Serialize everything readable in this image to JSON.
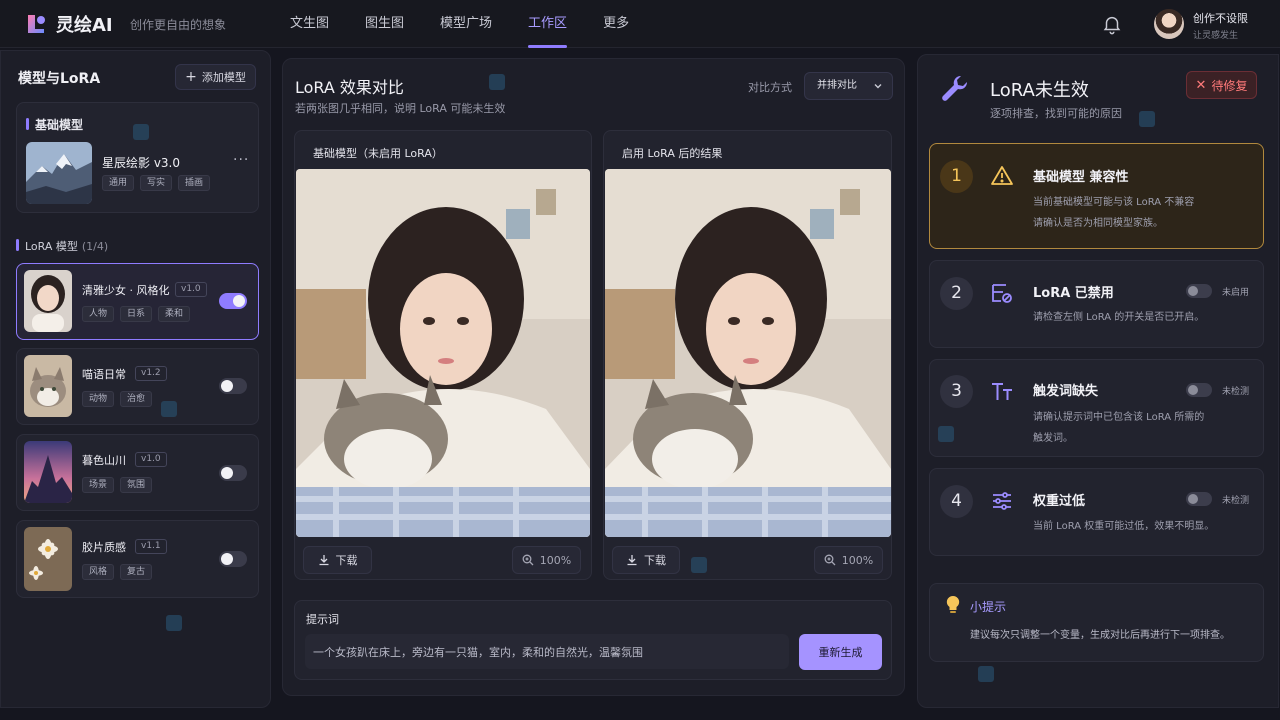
{
  "header": {
    "brand": "灵绘AI",
    "slogan": "创作更自由的想象",
    "nav": [
      "文生图",
      "图生图",
      "模型广场",
      "工作区",
      "更多"
    ],
    "active_nav": "工作区",
    "user_name": "创作不设限",
    "user_sub": "让灵感发生",
    "icons": [
      "logo-icon",
      "bell-icon",
      "avatar"
    ]
  },
  "left": {
    "title": "模型与LoRA",
    "add_button": "添加模型",
    "base_section": "基础模型",
    "base_model": {
      "name": "星辰绘影 v3.0",
      "tags": [
        "通用",
        "写实",
        "插画"
      ]
    },
    "lora_section": "LoRA 模型",
    "lora_count": "(1/4)",
    "loras": [
      {
        "name": "清雅少女 · 风格化",
        "version": "v1.0",
        "tags": [
          "人物",
          "日系",
          "柔和"
        ],
        "enabled": true
      },
      {
        "name": "喵语日常",
        "version": "v1.2",
        "tags": [
          "动物",
          "治愈"
        ],
        "enabled": false
      },
      {
        "name": "暮色山川",
        "version": "v1.0",
        "tags": [
          "场景",
          "氛围"
        ],
        "enabled": false
      },
      {
        "name": "胶片质感",
        "version": "v1.1",
        "tags": [
          "风格",
          "复古"
        ],
        "enabled": false
      }
    ]
  },
  "center": {
    "title": "LoRA 效果对比",
    "subtitle": "若两张图几乎相同，说明 LoRA 可能未生效",
    "compare_label": "对比方式",
    "compare_value": "并排对比",
    "left_image_title": "基础模型（未启用 LoRA）",
    "right_image_title": "启用 LoRA 后的结果",
    "download": "下载",
    "zoom": "100%",
    "prompt_label": "提示词",
    "prompt_value": "一个女孩趴在床上，旁边有一只猫，室内，柔和的自然光，温馨氛围",
    "regen_button": "重新生成"
  },
  "right": {
    "title": "LoRA未生效",
    "subtitle": "逐项排查，找到可能的原因",
    "badge": "待修复",
    "steps": [
      {
        "num": "1",
        "title": "基础模型  兼容性",
        "desc": [
          "当前基础模型可能与该 LoRA 不兼容",
          "请确认是否为相同模型家族。"
        ],
        "status": ""
      },
      {
        "num": "2",
        "title": "LoRA  已禁用",
        "desc": [
          "请检查左侧 LoRA 的开关是否已开启。"
        ],
        "status": "未启用"
      },
      {
        "num": "3",
        "title": "触发词缺失",
        "desc": [
          "请确认提示词中已包含该 LoRA 所需的",
          "触发词。"
        ],
        "status": "未检测"
      },
      {
        "num": "4",
        "title": "权重过低",
        "desc": [
          "当前 LoRA 权重可能过低，效果不明显。"
        ],
        "status": "未检测"
      }
    ],
    "tip_title": "小提示",
    "tip_text": "建议每次只调整一个变量，生成对比后再进行下一项排查。"
  },
  "colors": {
    "accent": "#8f7cff",
    "warning": "#f5c55a",
    "danger": "#ff7a7a",
    "background": "#15161f"
  }
}
